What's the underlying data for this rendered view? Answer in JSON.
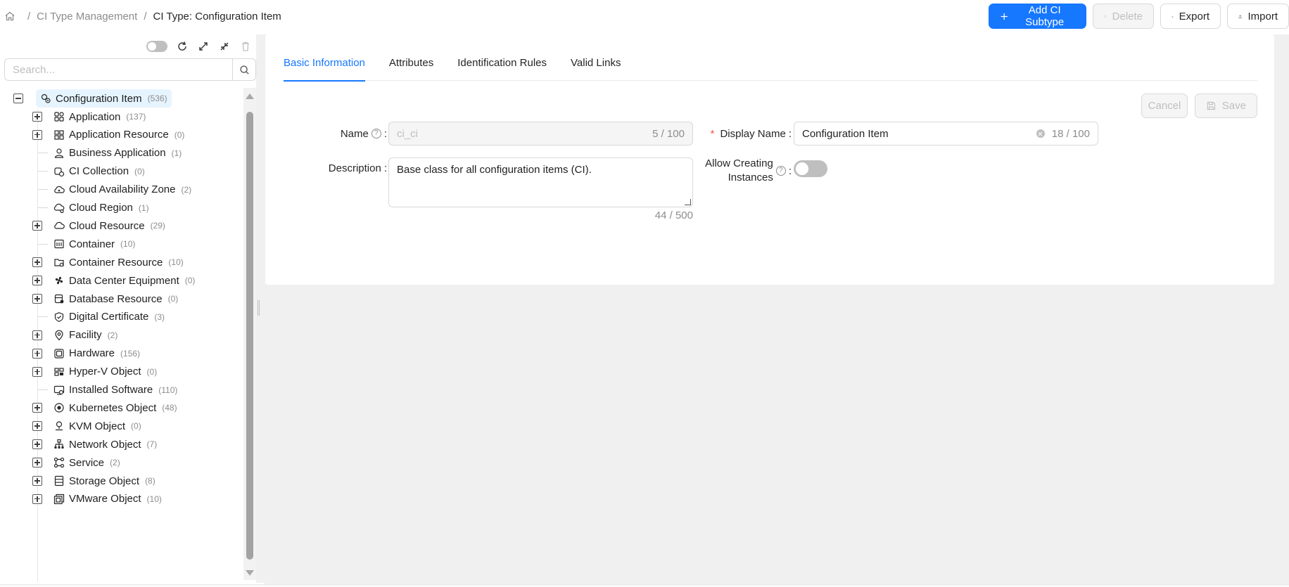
{
  "breadcrumb": {
    "items": [
      "CI Type Management",
      "CI Type: Configuration Item"
    ],
    "home_icon": "home-icon"
  },
  "actions": {
    "add_subtype": "Add CI Subtype",
    "delete": "Delete",
    "export": "Export",
    "import": "Import"
  },
  "colors": {
    "primary": "#1677ff",
    "selected_bg": "#e6f4ff",
    "required": "#ff4d4f"
  },
  "tree_panel": {
    "search_placeholder": "Search...",
    "root": {
      "label": "Configuration Item",
      "count": "(536)",
      "icon": "ci-gear-icon"
    },
    "items": [
      {
        "label": "Application",
        "count": "(137)",
        "expandable": true,
        "icon": "apps-icon"
      },
      {
        "label": "Application Resource",
        "count": "(0)",
        "expandable": true,
        "icon": "grid-icon"
      },
      {
        "label": "Business Application",
        "count": "(1)",
        "expandable": false,
        "icon": "business-icon"
      },
      {
        "label": "CI Collection",
        "count": "(0)",
        "expandable": false,
        "icon": "collection-icon"
      },
      {
        "label": "Cloud Availability Zone",
        "count": "(2)",
        "expandable": false,
        "icon": "cloud-zone-icon"
      },
      {
        "label": "Cloud Region",
        "count": "(1)",
        "expandable": false,
        "icon": "cloud-region-icon"
      },
      {
        "label": "Cloud Resource",
        "count": "(29)",
        "expandable": true,
        "icon": "cloud-icon"
      },
      {
        "label": "Container",
        "count": "(10)",
        "expandable": false,
        "icon": "container-icon"
      },
      {
        "label": "Container Resource",
        "count": "(10)",
        "expandable": true,
        "icon": "folder-icon"
      },
      {
        "label": "Data Center Equipment",
        "count": "(0)",
        "expandable": true,
        "icon": "fan-icon"
      },
      {
        "label": "Database Resource",
        "count": "(0)",
        "expandable": true,
        "icon": "database-icon"
      },
      {
        "label": "Digital Certificate",
        "count": "(3)",
        "expandable": false,
        "icon": "shield-icon"
      },
      {
        "label": "Facility",
        "count": "(2)",
        "expandable": true,
        "icon": "location-icon"
      },
      {
        "label": "Hardware",
        "count": "(156)",
        "expandable": true,
        "icon": "chip-icon"
      },
      {
        "label": "Hyper-V Object",
        "count": "(0)",
        "expandable": true,
        "icon": "hyperv-icon"
      },
      {
        "label": "Installed Software",
        "count": "(110)",
        "expandable": false,
        "icon": "software-icon"
      },
      {
        "label": "Kubernetes Object",
        "count": "(48)",
        "expandable": true,
        "icon": "kubernetes-icon"
      },
      {
        "label": "KVM Object",
        "count": "(0)",
        "expandable": true,
        "icon": "kvm-icon"
      },
      {
        "label": "Network Object",
        "count": "(7)",
        "expandable": true,
        "icon": "network-icon"
      },
      {
        "label": "Service",
        "count": "(2)",
        "expandable": true,
        "icon": "service-icon"
      },
      {
        "label": "Storage Object",
        "count": "(8)",
        "expandable": true,
        "icon": "storage-icon"
      },
      {
        "label": "VMware Object",
        "count": "(10)",
        "expandable": true,
        "icon": "vmware-icon"
      }
    ]
  },
  "tabs": [
    "Basic Information",
    "Attributes",
    "Identification Rules",
    "Valid Links"
  ],
  "form_actions": {
    "cancel": "Cancel",
    "save": "Save"
  },
  "form": {
    "name_label": "Name",
    "name_value": "ci_ci",
    "name_count": "5 / 100",
    "display_name_label": "Display Name",
    "display_name_value": "Configuration Item",
    "display_name_count": "18 / 100",
    "description_label": "Description",
    "description_value": "Base class for all configuration items (CI).",
    "description_count": "44 / 500",
    "allow_label_line1": "Allow Creating",
    "allow_label_line2": "Instances",
    "allow_value": false
  }
}
